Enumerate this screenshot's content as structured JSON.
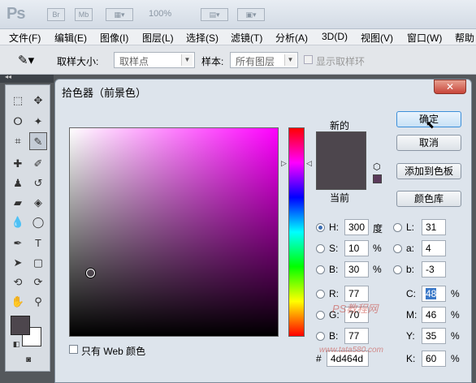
{
  "appbar": {
    "logo": "Ps",
    "br": "Br",
    "mb": "Mb",
    "zoom": "100%"
  },
  "menu": [
    "文件(F)",
    "编辑(E)",
    "图像(I)",
    "图层(L)",
    "选择(S)",
    "滤镜(T)",
    "分析(A)",
    "3D(D)",
    "视图(V)",
    "窗口(W)",
    "帮助"
  ],
  "options": {
    "sample_size_label": "取样大小:",
    "sample_size_value": "取样点",
    "sample_label": "样本:",
    "sample_value": "所有图层",
    "show_ring": "显示取样环"
  },
  "dialog": {
    "title": "拾色器（前景色）",
    "new_label": "新的",
    "current_label": "当前",
    "ok": "确定",
    "cancel": "取消",
    "add_swatch": "添加到色板",
    "color_library": "颜色库",
    "web_only": "只有 Web 颜色",
    "h_label": "H:",
    "h_value": "300",
    "h_unit": "度",
    "s_label": "S:",
    "s_value": "10",
    "s_unit": "%",
    "b_label": "B:",
    "b_value": "30",
    "b_unit": "%",
    "r_label": "R:",
    "r_value": "77",
    "g_label": "G:",
    "g_value": "70",
    "b2_label": "B:",
    "b2_value": "77",
    "l_label": "L:",
    "l_value": "31",
    "a_label": "a:",
    "a_value": "4",
    "lb_label": "b:",
    "lb_value": "-3",
    "c_label": "C:",
    "c_value": "48",
    "m_label": "M:",
    "m_value": "46",
    "y_label": "Y:",
    "y_value": "35",
    "k_label": "K:",
    "k_value": "60",
    "pct": "%",
    "hex_label": "#",
    "hex_value": "4d464d"
  },
  "colors": {
    "new": "#4d464d",
    "current": "#4d464d",
    "gamut": "#5a3a5a"
  },
  "watermark": {
    "text": "PS教程网",
    "url": "www.tata580.com"
  }
}
